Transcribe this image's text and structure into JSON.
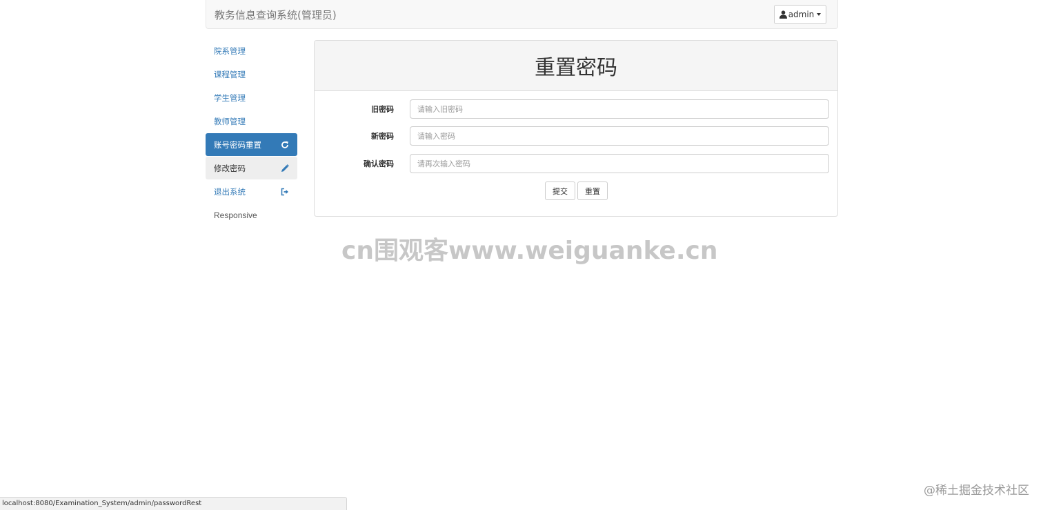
{
  "navbar": {
    "brand": "教务信息查询系统(管理员)",
    "user_label": "admin",
    "user_icon": "user-icon",
    "dropdown_icon": "caret-down-icon"
  },
  "sidebar": {
    "items": [
      {
        "label": "院系管理",
        "icon": ""
      },
      {
        "label": "课程管理",
        "icon": ""
      },
      {
        "label": "学生管理",
        "icon": ""
      },
      {
        "label": "教师管理",
        "icon": ""
      },
      {
        "label": "账号密码重置",
        "icon": "refresh-icon"
      },
      {
        "label": "修改密码",
        "icon": "pencil-icon"
      },
      {
        "label": "退出系统",
        "icon": "log-out-icon"
      },
      {
        "label": "Responsive",
        "icon": ""
      }
    ]
  },
  "panel": {
    "title": "重置密码",
    "fields": [
      {
        "label": "旧密码",
        "placeholder": "请输入旧密码"
      },
      {
        "label": "新密码",
        "placeholder": "请输入密码"
      },
      {
        "label": "确认密码",
        "placeholder": "请再次输入密码"
      }
    ],
    "submit_label": "提交",
    "reset_label": "重置"
  },
  "watermark": "cn围观客www.weiguanke.cn",
  "status_bar": "localhost:8080/Examination_System/admin/passwordRest",
  "corner_watermark": "@稀土掘金技术社区",
  "colors": {
    "accent": "#337ab7",
    "navbar_bg": "#f8f8f8",
    "panel_heading_bg": "#f5f5f5",
    "hover_bg": "#eeeeee"
  }
}
